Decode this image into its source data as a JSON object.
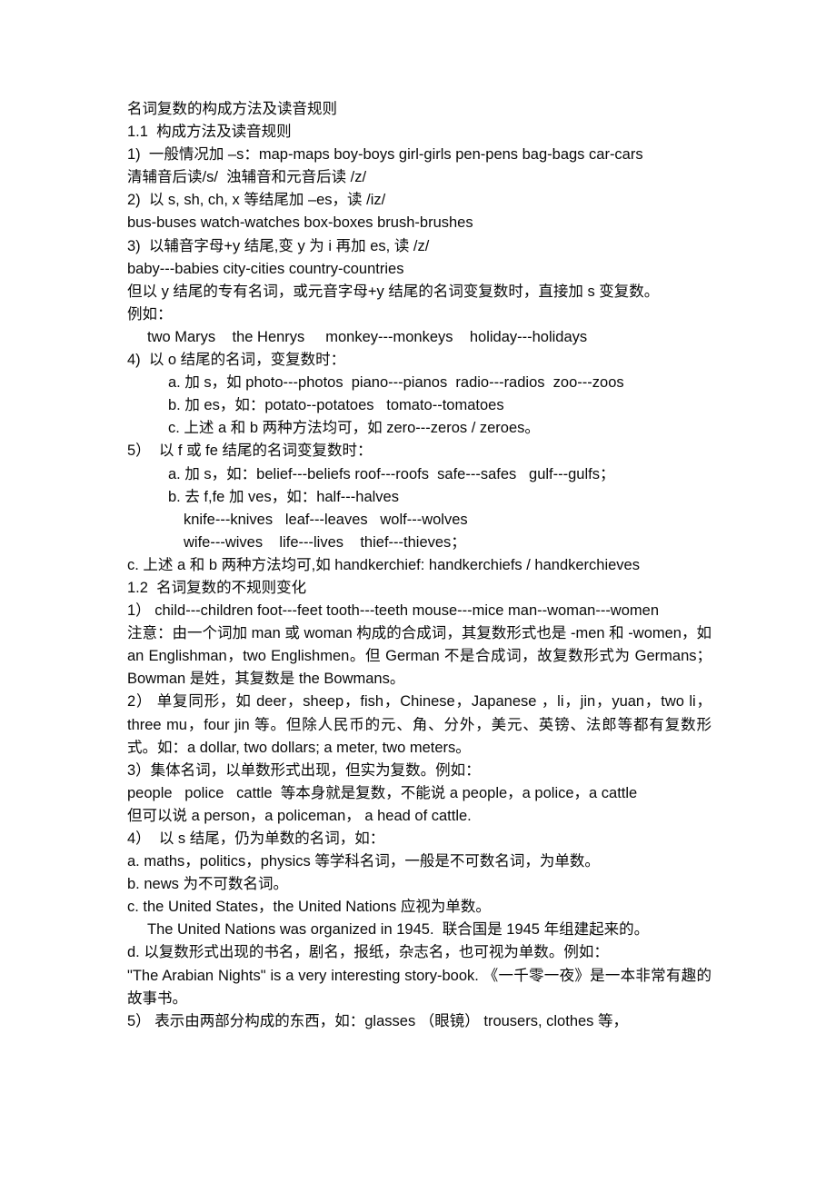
{
  "document": {
    "title": "名词复数的构成方法及读音规则",
    "lines": [
      {
        "id": "title",
        "indent": 0,
        "type": "line",
        "text": "名词复数的构成方法及读音规则"
      },
      {
        "id": "h-1-1",
        "indent": 0,
        "type": "line",
        "text": "1.1  构成方法及读音规则"
      },
      {
        "id": "r1",
        "indent": 0,
        "type": "line",
        "text": "1)  一般情况加 –s：map-maps boy-boys girl-girls pen-pens bag-bags car-cars"
      },
      {
        "id": "r1-note",
        "indent": 0,
        "type": "line",
        "text": "清辅音后读/s/  浊辅音和元音后读 /z/"
      },
      {
        "id": "r2",
        "indent": 0,
        "type": "line",
        "text": "2)  以 s, sh, ch, x 等结尾加 –es，读 /iz/"
      },
      {
        "id": "r2-ex",
        "indent": 0,
        "type": "line",
        "text": "bus-buses watch-watches box-boxes brush-brushes"
      },
      {
        "id": "r3",
        "indent": 0,
        "type": "line",
        "text": "3)  以辅音字母+y 结尾,变 y 为 i 再加 es, 读 /z/"
      },
      {
        "id": "r3-ex",
        "indent": 0,
        "type": "line",
        "text": "baby---babies city-cities country-countries"
      },
      {
        "id": "r3-note",
        "indent": 0,
        "type": "para",
        "text": "但以 y 结尾的专有名词，或元音字母+y 结尾的名词变复数时，直接加 s 变复数。"
      },
      {
        "id": "r3-eg",
        "indent": 0,
        "type": "line",
        "text": "例如："
      },
      {
        "id": "r3-eg-list",
        "indent": 1,
        "type": "line",
        "text": "two Marys    the Henrys     monkey---monkeys    holiday---holidays"
      },
      {
        "id": "r4",
        "indent": 0,
        "type": "line",
        "text": "4)  以 o 结尾的名词，变复数时："
      },
      {
        "id": "r4-a",
        "indent": 2,
        "type": "line",
        "text": "a. 加 s，如 photo---photos  piano---pianos  radio---radios  zoo---zoos"
      },
      {
        "id": "r4-b",
        "indent": 2,
        "type": "line",
        "text": "b. 加 es，如：potato--potatoes   tomato--tomatoes"
      },
      {
        "id": "r4-c",
        "indent": 2,
        "type": "line",
        "text": "c. 上述 a 和 b 两种方法均可，如 zero---zeros / zeroes。"
      },
      {
        "id": "r5",
        "indent": 0,
        "type": "line",
        "text": "5）  以 f 或 fe 结尾的名词变复数时："
      },
      {
        "id": "r5-a",
        "indent": 2,
        "type": "line",
        "text": "a. 加 s，如：belief---beliefs roof---roofs  safe---safes   gulf---gulfs；"
      },
      {
        "id": "r5-b",
        "indent": 2,
        "type": "line",
        "text": "b. 去 f,fe 加 ves，如：half---halves"
      },
      {
        "id": "r5-b2",
        "indent": 3,
        "type": "line",
        "text": "knife---knives   leaf---leaves   wolf---wolves"
      },
      {
        "id": "r5-b3",
        "indent": 3,
        "type": "line",
        "text": "wife---wives    life---lives    thief---thieves；"
      },
      {
        "id": "r5-c",
        "indent": 0,
        "type": "line",
        "text": "c. 上述 a 和 b 两种方法均可,如 handkerchief: handkerchiefs / handkerchieves"
      },
      {
        "id": "h-1-2",
        "indent": 0,
        "type": "line",
        "text": "1.2  名词复数的不规则变化"
      },
      {
        "id": "ir1",
        "indent": 0,
        "type": "para",
        "text": "1）  child---children   foot---feet   tooth---teeth    mouse---mice        man--woman---women"
      },
      {
        "id": "ir1-note",
        "indent": 0,
        "type": "para",
        "text": "注意：由一个词加 man 或 woman 构成的合成词，其复数形式也是 -men 和 -women，如 an Englishman，two Englishmen。但 German 不是合成词，故复数形式为 Germans；Bowman 是姓，其复数是 the Bowmans。"
      },
      {
        "id": "ir2",
        "indent": 0,
        "type": "para",
        "text": "2）  单复同形，如 deer，sheep，fish，Chinese，Japanese ，li，jin，yuan，two li，three mu，four jin 等。但除人民币的元、角、分外，美元、英镑、法郎等都有复数形式。如：a dollar, two dollars; a meter, two meters。"
      },
      {
        "id": "ir3",
        "indent": 0,
        "type": "line",
        "text": "3）集体名词，以单数形式出现，但实为复数。例如："
      },
      {
        "id": "ir3-ex1",
        "indent": 0,
        "type": "line",
        "text": "people   police   cattle  等本身就是复数，不能说 a people，a police，a cattle"
      },
      {
        "id": "ir3-ex2",
        "indent": 0,
        "type": "line",
        "text": "但可以说 a person，a policeman， a head of cattle."
      },
      {
        "id": "ir4",
        "indent": 0,
        "type": "line",
        "text": "4）  以 s 结尾，仍为单数的名词，如："
      },
      {
        "id": "ir4-a",
        "indent": 0,
        "type": "line",
        "text": "a. maths，politics，physics 等学科名词，一般是不可数名词，为单数。"
      },
      {
        "id": "ir4-b",
        "indent": 0,
        "type": "line",
        "text": "b. news 为不可数名词。"
      },
      {
        "id": "ir4-c",
        "indent": 0,
        "type": "line",
        "text": "c. the United States，the United Nations 应视为单数。"
      },
      {
        "id": "ir4-c-ex",
        "indent": 1,
        "type": "line",
        "text": "The United Nations was organized in 1945.  联合国是 1945 年组建起来的。"
      },
      {
        "id": "ir4-d",
        "indent": 0,
        "type": "line",
        "text": "d. 以复数形式出现的书名，剧名，报纸，杂志名，也可视为单数。例如："
      },
      {
        "id": "ir4-d-ex",
        "indent": 0,
        "type": "para",
        "text": "\"The Arabian Nights\" is a very interesting story-book.  《一千零一夜》是一本非常有趣的故事书。"
      },
      {
        "id": "ir5",
        "indent": 0,
        "type": "para",
        "text": "5）  表示由两部分构成的东西，如：glasses  （眼镜）   trousers,  clothes 等，"
      }
    ]
  },
  "style": {
    "text_color": "#0a0a0a",
    "background": "#ffffff"
  }
}
